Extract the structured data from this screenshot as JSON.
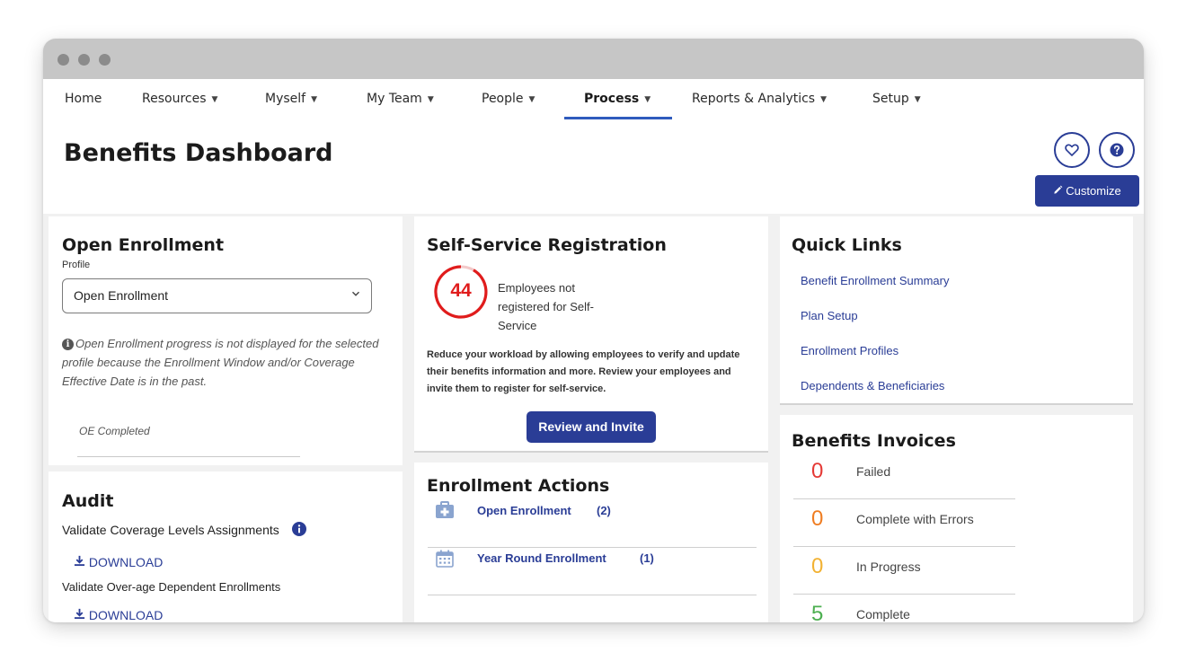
{
  "nav": {
    "items": [
      {
        "label": "Home",
        "dropdown": false
      },
      {
        "label": "Resources",
        "dropdown": true
      },
      {
        "label": "Myself",
        "dropdown": true
      },
      {
        "label": "My Team",
        "dropdown": true
      },
      {
        "label": "People",
        "dropdown": true
      },
      {
        "label": "Process",
        "dropdown": true,
        "active": true
      },
      {
        "label": "Reports & Analytics",
        "dropdown": true
      },
      {
        "label": "Setup",
        "dropdown": true
      }
    ],
    "chevron_glyph": "▼"
  },
  "header": {
    "title": "Benefits Dashboard",
    "favorite_icon": "heart-icon",
    "help_icon": "question-icon",
    "customize_label": "Customize"
  },
  "open_enrollment": {
    "title": "Open Enrollment",
    "profile_label": "Profile",
    "profile_value": "Open Enrollment",
    "info_glyph": "i",
    "note": "Open Enrollment progress is not displayed for the selected profile because the Enrollment Window and/or Coverage Effective Date is in the past.",
    "status": "OE Completed"
  },
  "audit": {
    "title": "Audit",
    "items": [
      {
        "label": "Validate Coverage Levels Assignments",
        "download_label": "DOWNLOAD"
      },
      {
        "label": "Validate Over-age Dependent Enrollments",
        "download_label": "DOWNLOAD"
      }
    ]
  },
  "self_service": {
    "title": "Self-Service Registration",
    "count": "44",
    "count_label": "Employees not registered for Self-Service",
    "description": "Reduce your workload by allowing employees to verify and update their benefits information and more. Review your employees and invite them to register for self-service.",
    "button_label": "Review and Invite"
  },
  "enrollment_actions": {
    "title": "Enrollment Actions",
    "items": [
      {
        "label": "Open Enrollment",
        "count": "(2)",
        "icon": "medical-kit-icon"
      },
      {
        "label": "Year Round Enrollment",
        "count": "(1)",
        "icon": "calendar-icon"
      }
    ]
  },
  "quick_links": {
    "title": "Quick Links",
    "items": [
      "Benefit Enrollment Summary",
      "Plan Setup",
      "Enrollment Profiles",
      "Dependents & Beneficiaries"
    ]
  },
  "benefits_invoices": {
    "title": "Benefits Invoices",
    "items": [
      {
        "value": "0",
        "label": "Failed",
        "color": "#e53935"
      },
      {
        "value": "0",
        "label": "Complete with Errors",
        "color": "#ef7d22"
      },
      {
        "value": "0",
        "label": "In Progress",
        "color": "#f2b233"
      },
      {
        "value": "5",
        "label": "Complete",
        "color": "#4caf50"
      }
    ]
  },
  "colors": {
    "brand": "#2a3d96",
    "alert_red": "#e01c1c"
  }
}
